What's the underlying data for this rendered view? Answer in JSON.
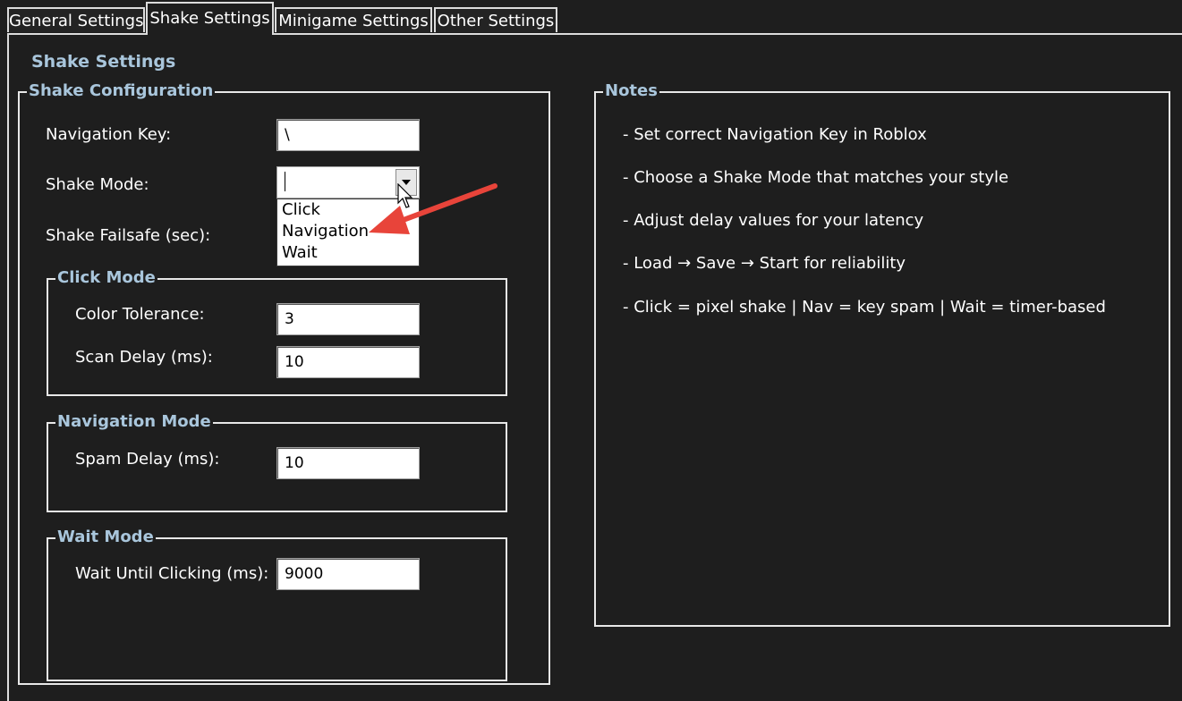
{
  "tabs": [
    "General Settings",
    "Shake Settings",
    "Minigame Settings",
    "Other Settings"
  ],
  "page_title": "Shake Settings",
  "config_group": {
    "title": "Shake Configuration",
    "navigation_key_label": "Navigation Key:",
    "navigation_key_value": "\\",
    "shake_mode_label": "Shake Mode:",
    "shake_mode_value": "",
    "shake_mode_options": [
      "Click",
      "Navigation",
      "Wait"
    ],
    "failsafe_label": "Shake Failsafe (sec):"
  },
  "click_mode": {
    "title": "Click Mode",
    "color_tolerance_label": "Color Tolerance:",
    "color_tolerance_value": "3",
    "scan_delay_label": "Scan Delay (ms):",
    "scan_delay_value": "10"
  },
  "navigation_mode": {
    "title": "Navigation Mode",
    "spam_delay_label": "Spam Delay (ms):",
    "spam_delay_value": "10"
  },
  "wait_mode": {
    "title": "Wait Mode",
    "wait_label": "Wait Until Clicking (ms):",
    "wait_value": "9000"
  },
  "notes": {
    "title": "Notes",
    "items": [
      "- Set correct Navigation Key in Roblox",
      "- Choose a Shake Mode that matches your style",
      "- Adjust delay values for your latency",
      "- Load → Save → Start for reliability",
      "- Click = pixel shake | Nav = key spam | Wait = timer-based"
    ]
  },
  "colors": {
    "background": "#1e1e1e",
    "heading": "#a9c6dc",
    "annotation_arrow": "#e8443a"
  },
  "icons": {
    "dropdown": "chevron-down-icon",
    "pointer": "mouse-pointer-icon",
    "annotation": "red-arrow-annotation"
  }
}
